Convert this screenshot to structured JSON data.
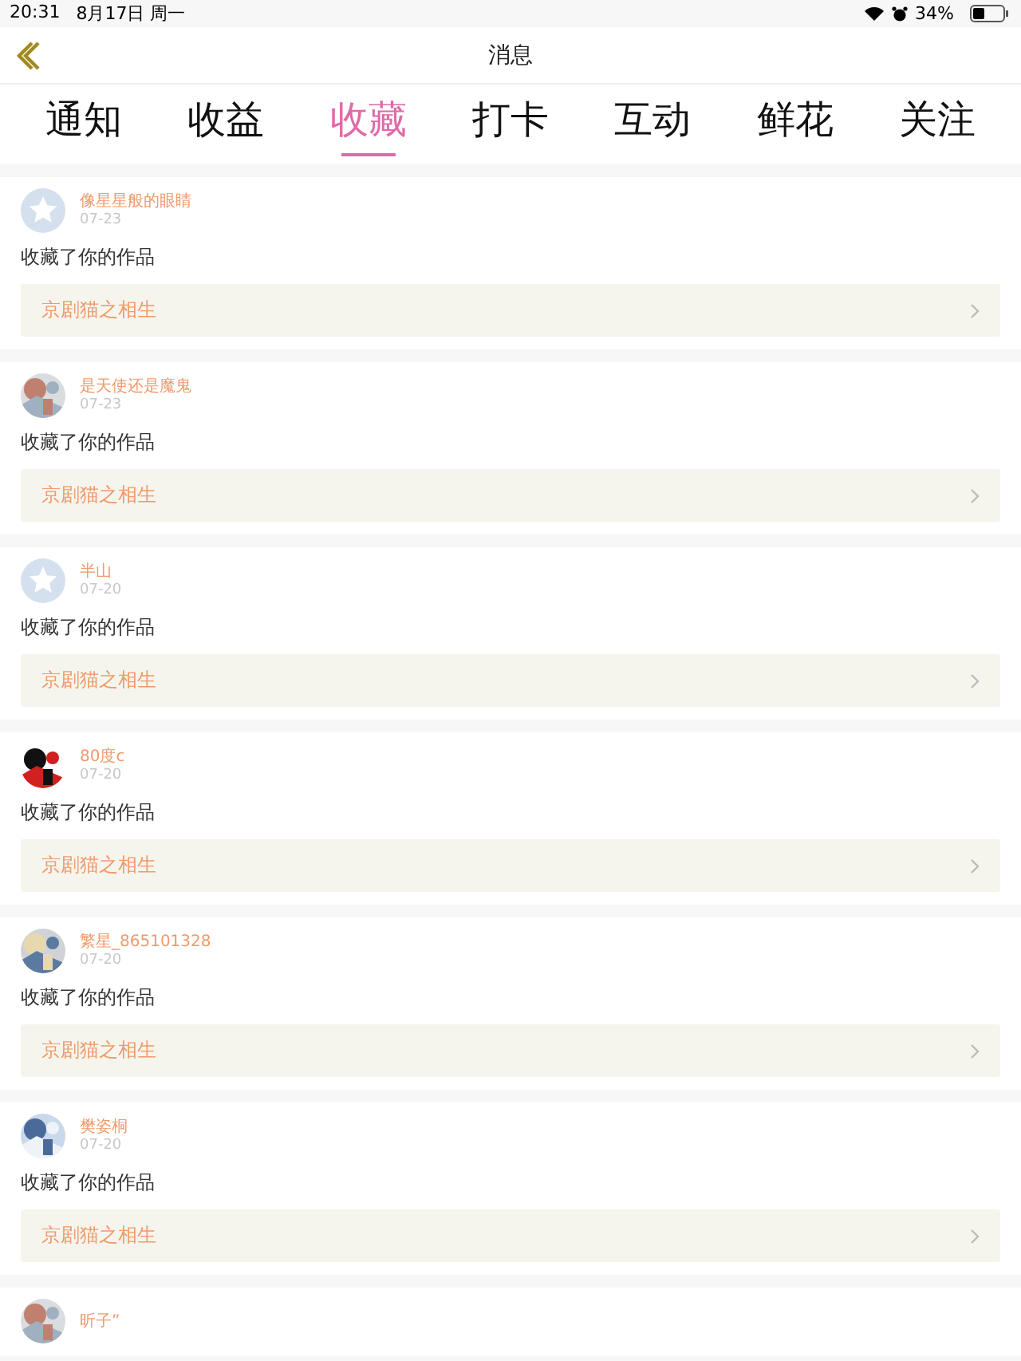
{
  "status_bar": {
    "time": "20:31",
    "date": "8月17日 周一",
    "battery": "34%"
  },
  "nav": {
    "title": "消息"
  },
  "tabs": [
    {
      "label": "通知",
      "selected": false
    },
    {
      "label": "收益",
      "selected": false
    },
    {
      "label": "收藏",
      "selected": true
    },
    {
      "label": "打卡",
      "selected": false
    },
    {
      "label": "互动",
      "selected": false
    },
    {
      "label": "鲜花",
      "selected": false
    },
    {
      "label": "关注",
      "selected": false
    }
  ],
  "messages": [
    {
      "kind": "default",
      "name": "像星星般的眼睛",
      "date": "07-23",
      "action": "收藏了你的作品",
      "work": "京剧猫之相生"
    },
    {
      "name": "是天使还是魔鬼",
      "date": "07-23",
      "action": "收藏了你的作品",
      "work": "京剧猫之相生"
    },
    {
      "kind": "default",
      "name": "半山",
      "date": "07-20",
      "action": "收藏了你的作品",
      "work": "京剧猫之相生"
    },
    {
      "name": "80度c",
      "date": "07-20",
      "action": "收藏了你的作品",
      "work": "京剧猫之相生"
    },
    {
      "name": "繁星_865101328",
      "date": "07-20",
      "action": "收藏了你的作品",
      "work": "京剧猫之相生"
    },
    {
      "name": "樊姿桐",
      "date": "07-20",
      "action": "收藏了你的作品",
      "work": "京剧猫之相生"
    },
    {
      "name": "昕子”"
    }
  ]
}
